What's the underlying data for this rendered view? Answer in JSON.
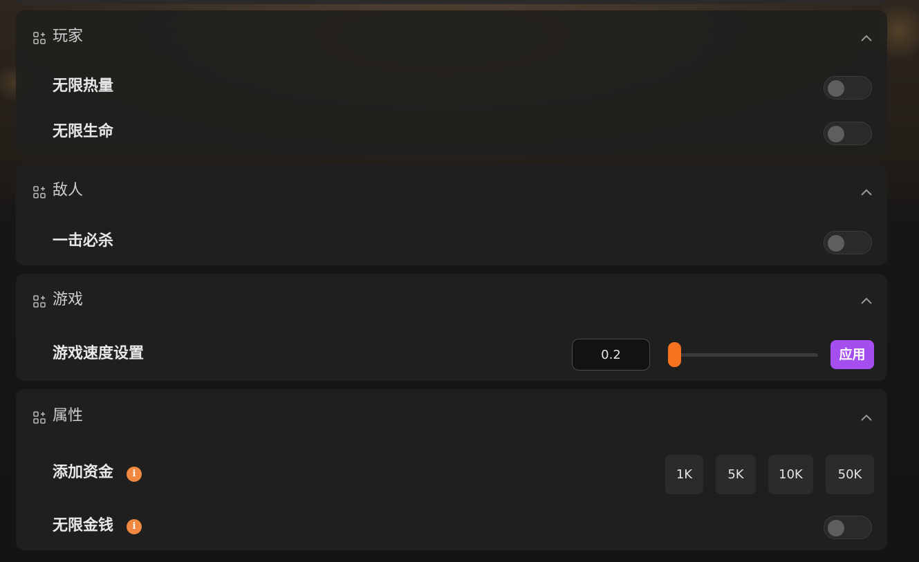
{
  "colors": {
    "panel_bg": "#1f1f1f",
    "accent_slider": "#f5731f",
    "accent_apply": "#a44ef0",
    "info_icon": "#f0893f",
    "toggle_off": "#2a2a2a"
  },
  "icons": {
    "section": "grid-plus-icon",
    "collapse": "chevron-up-icon",
    "info": "info-icon"
  },
  "sections": {
    "player": {
      "title": "玩家",
      "rows": [
        {
          "label": "无限热量",
          "toggle_on": false
        },
        {
          "label": "无限生命",
          "toggle_on": false
        }
      ]
    },
    "enemy": {
      "title": "敌人",
      "rows": [
        {
          "label": "一击必杀",
          "toggle_on": false
        }
      ]
    },
    "game": {
      "title": "游戏",
      "speed": {
        "label": "游戏速度设置",
        "value": "0.2",
        "slider_fraction": 0.0,
        "apply_label": "应用"
      }
    },
    "attributes": {
      "title": "属性",
      "add_money": {
        "label": "添加资金",
        "info": "i",
        "buttons": [
          "1K",
          "5K",
          "10K",
          "50K"
        ]
      },
      "infinite_money": {
        "label": "无限金钱",
        "info": "i",
        "toggle_on": false
      }
    }
  }
}
